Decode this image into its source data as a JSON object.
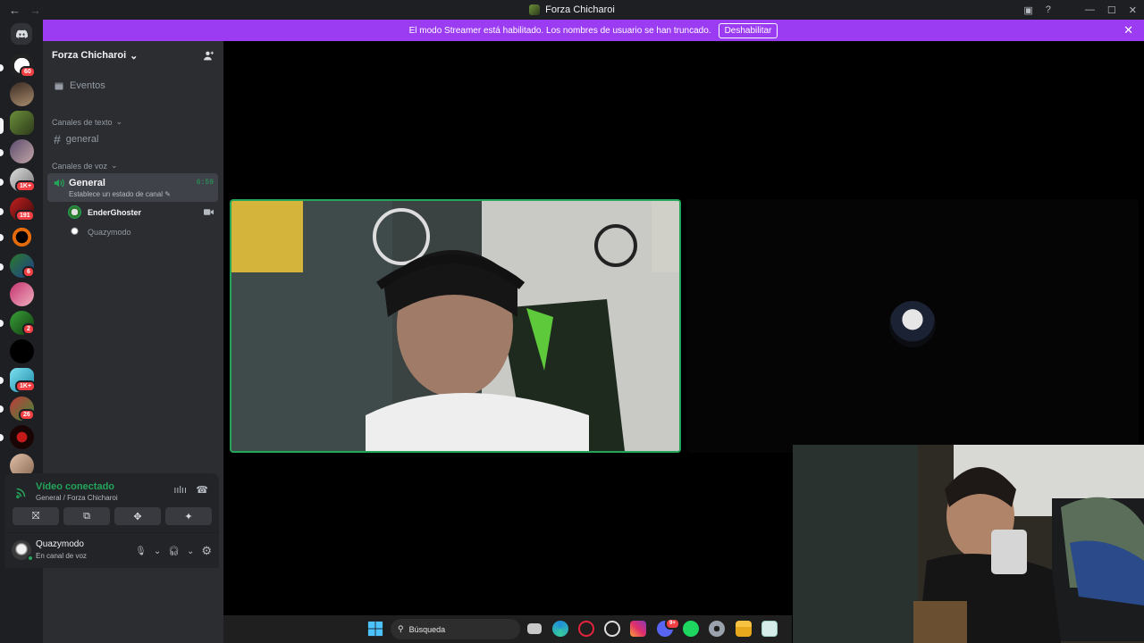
{
  "window": {
    "title": "Forza Chicharoi",
    "nav_back": "←",
    "nav_forward": "→",
    "controls": {
      "minimize": "—",
      "maximize": "☐",
      "close": "✕",
      "inbox": "▣",
      "help": "?"
    }
  },
  "banner": {
    "message": "El modo Streamer está habilitado. Los nombres de usuario se han truncado.",
    "button_label": "Deshabilitar",
    "close": "✕"
  },
  "servers": {
    "badges": [
      "60",
      "1K+",
      "191",
      "6",
      "2",
      "1K+",
      "26"
    ],
    "add": "+"
  },
  "guild": {
    "name": "Forza Chicharoi",
    "events_label": "Eventos",
    "text_category": "Canales de texto",
    "text_channel": "general",
    "voice_category": "Canales de voz",
    "voice_channel": {
      "name": "General",
      "status_placeholder": "Establece un estado de canal",
      "timer": "6:59"
    },
    "voice_users": [
      "EnderGhoster",
      "Quazymodo"
    ]
  },
  "voice_panel": {
    "status": "Vídeo conectado",
    "location": "General / Forza Chicharoi"
  },
  "user": {
    "name": "Quazymodo",
    "status": "En canal de voz"
  },
  "taskbar": {
    "search_label": "Búsqueda",
    "discord_badge": "9+"
  },
  "colors": {
    "brand_banner": "#9b3bf2",
    "speaking_border": "#23a55a",
    "sidebar_bg": "#2b2d31",
    "server_rail_bg": "#1e1f22"
  }
}
